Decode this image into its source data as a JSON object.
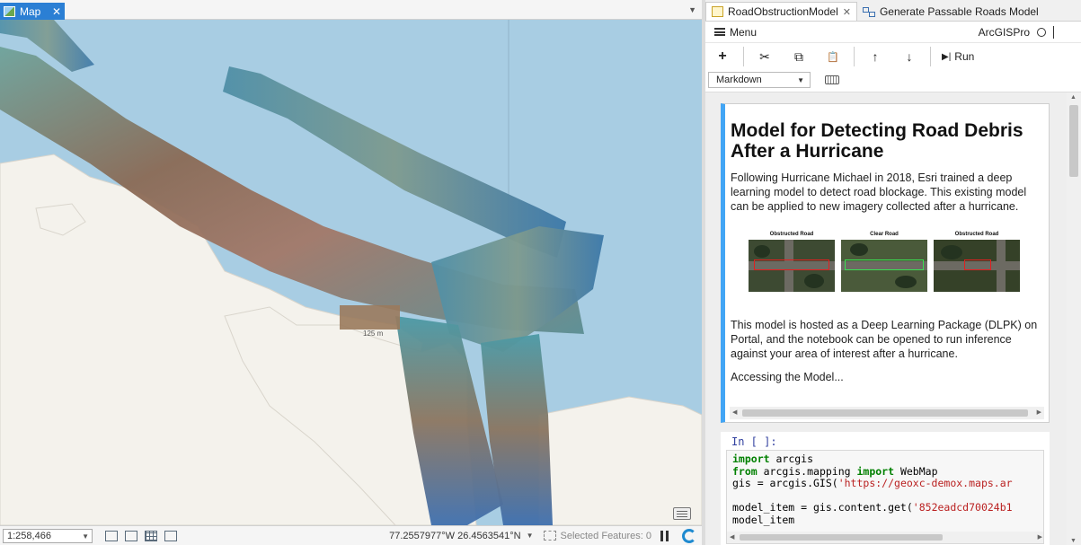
{
  "map_pane": {
    "tab_label": "Map",
    "tab_close": "✕",
    "tab_dropdown": "▼",
    "scale_marker": "125 m",
    "status_bar": {
      "scale_value": "1:258,466",
      "coordinates": "77.2557977°W 26.4563541°N",
      "selected_features": "Selected Features: 0"
    },
    "colors": {
      "water": "#a8cde3",
      "land": "#f4f2ec",
      "accent": "#2b7fd4"
    }
  },
  "notebook_pane": {
    "tabs": [
      {
        "label": "RoadObstructionModel",
        "close": "✕"
      },
      {
        "label": "Generate Passable Roads Model"
      }
    ],
    "menu_label": "Menu",
    "kernel_name": "ArcGISPro",
    "toolbar": {
      "add": "+",
      "cut": "✂",
      "copy": "⧉",
      "paste": "📋",
      "move_up": "↑",
      "move_down": "↓",
      "run_glyph": "▶|",
      "run_label": "Run"
    },
    "cell_type": "Markdown",
    "markdown_cell": {
      "title": "Model for Detecting Road Debris After a Hurricane",
      "paragraph1": "Following Hurricane Michael in 2018, Esri trained a deep learning model to detect road blockage. This existing model can be applied to new imagery collected after a hurricane.",
      "figure_labels": [
        "Obstructed Road",
        "Clear Road",
        "Obstructed Road"
      ],
      "paragraph2": "This model is hosted as a Deep Learning Package (DLPK) on Portal, and the notebook can be opened to run inference against your area of interest after a hurricane.",
      "paragraph3": "Accessing the Model..."
    },
    "code_cell": {
      "prompt": "In [ ]:",
      "lines": [
        {
          "kw": "import",
          "rest": " arcgis"
        },
        {
          "kw": "from",
          "mid": " arcgis.mapping ",
          "kw2": "import",
          "rest2": " WebMap"
        },
        {
          "plain": "gis = arcgis.GIS(",
          "str": "'https://geoxc-demox.maps.ar"
        },
        {
          "plain": ""
        },
        {
          "plain": "model_item = gis.content.get(",
          "str": "'852eadcd70024b1"
        },
        {
          "plain": "model_item"
        }
      ]
    },
    "colors": {
      "md_accent": "#42a5f5",
      "prompt": "#303f9f",
      "keyword": "#008000",
      "string": "#ba2121"
    }
  }
}
